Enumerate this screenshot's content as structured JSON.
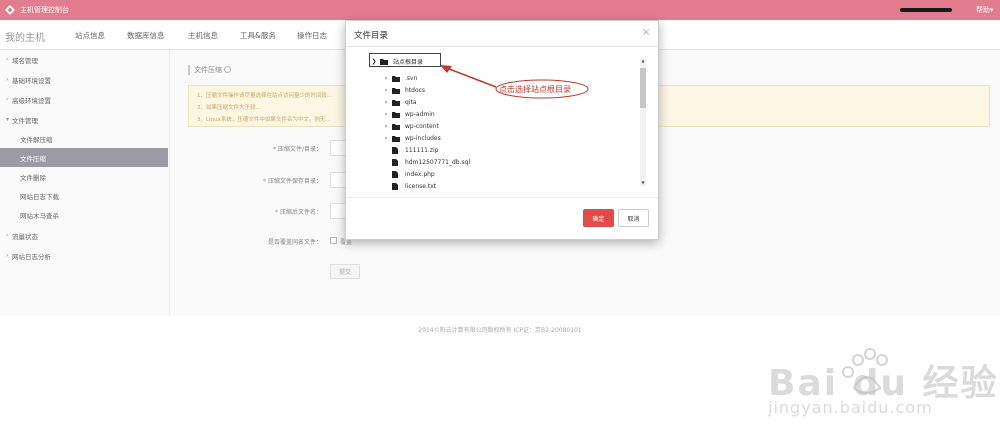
{
  "topbar": {
    "app_title": "主机管理控制台",
    "help": "帮助▾"
  },
  "navbar": {
    "my_host": "我的主机",
    "items": [
      "站点信息",
      "数据库信息",
      "主机信息",
      "工具&服务",
      "操作日志"
    ]
  },
  "sidebar": {
    "items": [
      {
        "label": "域名管理",
        "caret": "›"
      },
      {
        "label": "基础环境设置",
        "caret": "›"
      },
      {
        "label": "高级环境设置",
        "caret": "›"
      },
      {
        "label": "文件管理",
        "caret": "▾"
      },
      {
        "label": "文件解压缩"
      },
      {
        "label": "文件压缩"
      },
      {
        "label": "文件删除"
      },
      {
        "label": "网站日志下载"
      },
      {
        "label": "网站木马查杀"
      },
      {
        "label": "流量状态",
        "caret": "›"
      },
      {
        "label": "网站日志分析",
        "caret": "›"
      }
    ]
  },
  "main": {
    "section_title": "文件压缩",
    "notice": [
      "1、压缩文件操作请尽量选择在站点访问量少的时间段...",
      "2、如果压缩文件大于较...",
      "3、Linux系统，压缩文件中如果文件名为中文，则无..."
    ],
    "form": {
      "source_label": "压缩文件/目录：",
      "target_label": "压缩文件保存目录：",
      "name_label": "压缩后文件名：",
      "overwrite_label": "是否覆盖同名文件：",
      "overwrite_option": "覆盖",
      "submit": "提交"
    }
  },
  "modal": {
    "title": "文件目录",
    "close": "×",
    "root": "站点根目录",
    "items": [
      {
        "name": ".svn",
        "type": "folder"
      },
      {
        "name": "htdocs",
        "type": "folder"
      },
      {
        "name": "qita",
        "type": "folder"
      },
      {
        "name": "wp-admin",
        "type": "folder"
      },
      {
        "name": "wp-content",
        "type": "folder"
      },
      {
        "name": "wp-includes",
        "type": "folder"
      },
      {
        "name": "111111.zip",
        "type": "file"
      },
      {
        "name": "hdm12507771_db.sql",
        "type": "file"
      },
      {
        "name": "index.php",
        "type": "file"
      },
      {
        "name": "license.txt",
        "type": "file"
      }
    ],
    "ok": "确定",
    "cancel": "取消"
  },
  "annotation": {
    "text": "点击选择站点根目录"
  },
  "footer": {
    "copyright": "2014©阳云计算有限公司版权所有 ICP证：京B2-20080101"
  },
  "watermark": {
    "brand": "Bai du 经验",
    "url": "jingyan.baidu.com"
  },
  "colors": {
    "topbar": "#e27d8f",
    "active_side": "#9b9aa6",
    "primary_button": "#e34b4b",
    "annotation": "#c0392b"
  }
}
